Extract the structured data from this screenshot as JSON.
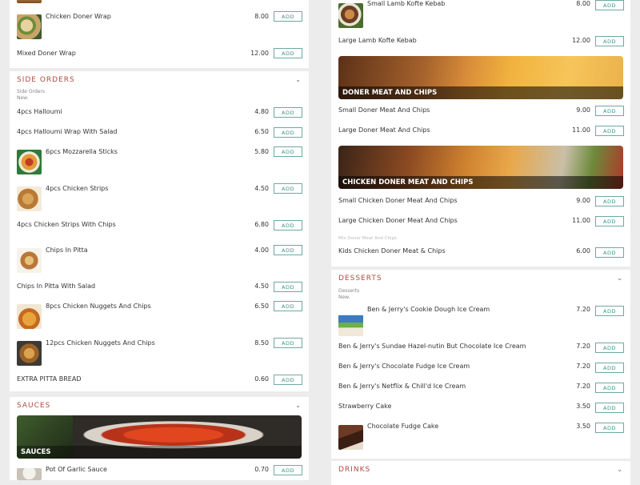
{
  "add_label": "ADD",
  "left": {
    "top_items": [
      {
        "name": "Chicken Doner Wrap",
        "price": "8.00"
      },
      {
        "name": "Mixed Doner Wrap",
        "price": "12.00"
      }
    ],
    "side_orders": {
      "title": "SIDE ORDERS",
      "sub_1": "Side Orders",
      "sub_2": "New.",
      "items": [
        {
          "name": "4pcs Halloumi",
          "price": "4.80"
        },
        {
          "name": "4pcs Halloumi Wrap With Salad",
          "price": "6.50"
        },
        {
          "name": "6pcs Mozzarella Sticks",
          "price": "5.80"
        },
        {
          "name": "4pcs Chicken Strips",
          "price": "4.50"
        },
        {
          "name": "4pcs Chicken Strips With Chips",
          "price": "6.80"
        },
        {
          "name": "Chips In Pitta",
          "price": "4.00"
        },
        {
          "name": "Chips In Pitta With Salad",
          "price": "4.50"
        },
        {
          "name": "8pcs Chicken Nuggets And Chips",
          "price": "6.50"
        },
        {
          "name": "12pcs Chicken Nuggets And Chips",
          "price": "8.50"
        },
        {
          "name": "EXTRA PITTA BREAD",
          "price": "0.60"
        }
      ]
    },
    "sauces": {
      "title": "SAUCES",
      "banner": "SAUCES",
      "items": [
        {
          "name": "Pot Of Garlic Sauce",
          "price": "0.70"
        }
      ]
    }
  },
  "right": {
    "top_items": [
      {
        "name": "Small Lamb Kofte Kebab",
        "price": "8.00"
      },
      {
        "name": "Large Lamb Kofte Kebab",
        "price": "12.00"
      }
    ],
    "doner_chips": {
      "banner": "DONER MEAT AND CHIPS",
      "items": [
        {
          "name": "Small Doner Meat And Chips",
          "price": "9.00"
        },
        {
          "name": "Large Doner Meat And Chips",
          "price": "11.00"
        }
      ]
    },
    "chicken_doner_chips": {
      "banner": "CHICKEN DONER MEAT AND CHIPS",
      "items": [
        {
          "name": "Small Chicken Doner Meat And Chips",
          "price": "9.00"
        },
        {
          "name": "Large Chicken Doner Meat And Chips",
          "price": "11.00"
        }
      ],
      "faded": "Mix Doner Meat And Chips",
      "kids": {
        "name": "Kids Chicken Doner Meat & Chips",
        "price": "6.00"
      }
    },
    "desserts": {
      "title": "DESSERTS",
      "sub_1": "Desserts",
      "sub_2": "New.",
      "items": [
        {
          "name": "Ben & Jerry's Cookie Dough Ice Cream",
          "price": "7.20"
        },
        {
          "name": "Ben & Jerry's Sundae Hazel-nutin But Chocolate Ice Cream",
          "price": "7.20"
        },
        {
          "name": "Ben & Jerry's Chocolate Fudge Ice Cream",
          "price": "7.20"
        },
        {
          "name": "Ben & Jerry's Netflix & Chill'd Ice Cream",
          "price": "7.20"
        },
        {
          "name": "Strawberry Cake",
          "price": "3.50"
        },
        {
          "name": "Chocolate Fudge Cake",
          "price": "3.50"
        }
      ]
    },
    "drinks": {
      "title": "DRINKS"
    }
  }
}
